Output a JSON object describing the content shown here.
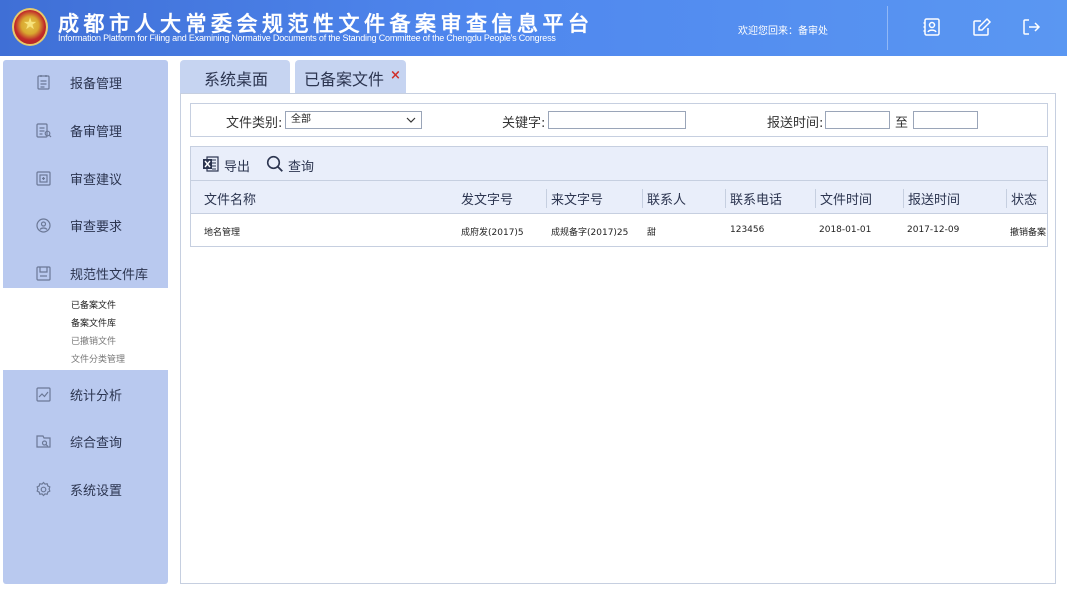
{
  "header": {
    "title_cn": "成都市人大常委会规范性文件备案审查信息平台",
    "title_en": "Information Platform for Filing and Examining Normative Documents of the Standing Committee of the Chengdu People's Congress",
    "welcome": "欢迎您回来：备审处",
    "icons": [
      "contacts-icon",
      "edit-icon",
      "logout-icon"
    ]
  },
  "sidebar": {
    "items": [
      {
        "label": "报备管理",
        "icon": "filing-icon"
      },
      {
        "label": "备审管理",
        "icon": "review-icon"
      },
      {
        "label": "审查建议",
        "icon": "suggestion-icon"
      },
      {
        "label": "审查要求",
        "icon": "request-icon"
      },
      {
        "label": "规范性文件库",
        "icon": "library-icon"
      },
      {
        "label": "统计分析",
        "icon": "statistics-icon"
      },
      {
        "label": "综合查询",
        "icon": "query-icon"
      },
      {
        "label": "系统设置",
        "icon": "settings-icon"
      }
    ],
    "submenu": [
      {
        "label": "已备案文件"
      },
      {
        "label": "备案文件库"
      },
      {
        "label": "已撤销文件"
      },
      {
        "label": "文件分类管理"
      }
    ]
  },
  "tabs": [
    {
      "label": "系统桌面"
    },
    {
      "label": "已备案文件",
      "close": "×"
    }
  ],
  "filter": {
    "category_label": "文件类别:",
    "category_value": "全部",
    "keyword_label": "关键字:",
    "keyword_value": "",
    "time_label": "报送时间:",
    "time_to": "至"
  },
  "toolbar": {
    "export_label": "导出",
    "query_label": "查询"
  },
  "table": {
    "columns": [
      "文件名称",
      "发文字号",
      "来文字号",
      "联系人",
      "联系电话",
      "文件时间",
      "报送时间",
      "状态"
    ],
    "rows": [
      [
        "地名管理",
        "成府发(2017)5",
        "成规备字(2017)25",
        "甜",
        "123456",
        "2018-01-01",
        "2017-12-09",
        "撤销备案"
      ]
    ]
  },
  "colors": {
    "header_blue": "#4f87ee",
    "sidebar_bg": "#b9c9ef",
    "tab_bg": "#c6d4f1",
    "close_red": "#d0302b"
  }
}
